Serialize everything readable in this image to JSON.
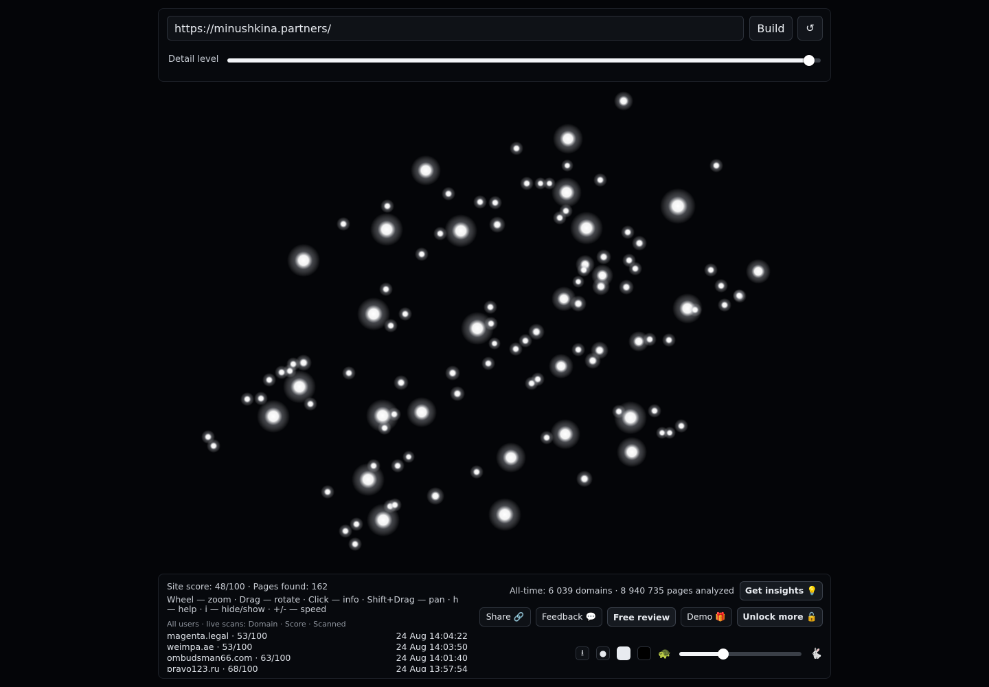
{
  "toolbar": {
    "url_value": "https://minushkina.partners/",
    "build_label": "Build",
    "refresh_label": "↺"
  },
  "detail": {
    "label": "Detail level",
    "level": 0.98
  },
  "stats": {
    "site_summary": "Site score: 48/100 · Pages found: 162",
    "help": "Wheel — zoom · Drag — rotate · Click — info · Shift+Drag — pan · h — help · i — hide/show · +/- — speed",
    "all_time": "All-time: 6 039 domains · 8 940 735 pages analyzed"
  },
  "scans": {
    "header": "All users · live scans: Domain · Score · Scanned",
    "rows": [
      {
        "domain": "magenta.legal · 53/100",
        "time": "24 Aug 14:04:22"
      },
      {
        "domain": "weimpa.ae · 53/100",
        "time": "24 Aug 14:03:50"
      },
      {
        "domain": "ombudsman66.com · 63/100",
        "time": "24 Aug 14:01:40"
      },
      {
        "domain": "pravo123.ru · 68/100",
        "time": "24 Aug 13:57:54"
      }
    ]
  },
  "actions": {
    "insights": "Get insights 💡",
    "share": "Share 🔗",
    "feedback": "Feedback 💬",
    "free_review": "Free review",
    "demo": "Demo 🎁",
    "unlock": "Unlock more 🔓"
  },
  "controls": {
    "download_icon": "⭳",
    "dot_icon": "●",
    "slow_emoji": "🐢",
    "fast_emoji": "🐇",
    "speed_level": 0.36
  },
  "colors": {
    "background": "#040508",
    "node": "#ffffff"
  }
}
